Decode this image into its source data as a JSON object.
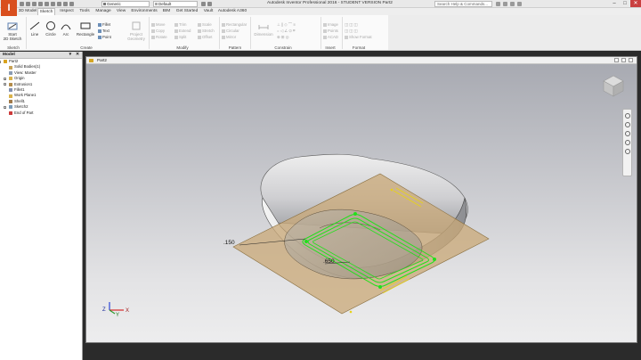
{
  "app": {
    "logo_letter": "I",
    "title": "Autodesk Inventor Professional 2016 - STUDENT VERSION   Part2",
    "search_placeholder": "Search Help & Commands...",
    "quick_access": {
      "material": "Generic",
      "appearance": "Default"
    },
    "window_controls": {
      "minimize": "–",
      "maximize": "□",
      "close": "✕"
    }
  },
  "ribbon": {
    "tabs": [
      "3D Model",
      "Sketch",
      "Inspect",
      "Tools",
      "Manage",
      "View",
      "Environments",
      "BIM",
      "Get Started",
      "Vault",
      "Autodesk A360"
    ],
    "active_tab": "Sketch",
    "start_sketch": {
      "line1": "Start",
      "line2": "2D Sketch"
    },
    "create": {
      "line": "Line",
      "circle": "Circle",
      "arc": "Arc",
      "rectangle": "Rectangle",
      "fillet": "Fillet",
      "text": "Text",
      "point": "Point"
    },
    "project_geometry": {
      "line1": "Project",
      "line2": "Geometry"
    },
    "modify": [
      "Move",
      "Copy",
      "Rotate",
      "Trim",
      "Extend",
      "Split",
      "Scale",
      "Stretch",
      "Offset"
    ],
    "pattern": [
      "Rectangular",
      "Circular",
      "Mirror"
    ],
    "constrain": {
      "dimension": "Dimension"
    },
    "insert": [
      "Image",
      "Points",
      "ACAD"
    ],
    "format": [
      "Show Format"
    ],
    "groups": {
      "sketch": "Sketch",
      "create": "Create",
      "modify": "Modify",
      "pattern": "Pattern",
      "constrain": "Constrain",
      "insert": "Insert",
      "format": "Format"
    }
  },
  "browser": {
    "title": "Model",
    "dropdown": "▾",
    "close": "✕",
    "items": [
      {
        "label": "Part2",
        "icon_color": "#d8a21d"
      },
      {
        "label": "Solid Bodies(1)",
        "icon_color": "#c8a254"
      },
      {
        "label": "View: Master",
        "icon_color": "#8a9bb3"
      },
      {
        "label": "Origin",
        "icon_color": "#d9b24a"
      },
      {
        "label": "Extrusion1",
        "icon_color": "#b38c4a"
      },
      {
        "label": "Fillet1",
        "icon_color": "#7f8fb0"
      },
      {
        "label": "Work Plane1",
        "icon_color": "#d9b24a"
      },
      {
        "label": "Shell1",
        "icon_color": "#a07a4a"
      },
      {
        "label": "Sketch2",
        "icon_color": "#7a9ab8"
      },
      {
        "label": "End of Part",
        "icon_color": "#cc3a3a"
      }
    ]
  },
  "document": {
    "tab": "Part2"
  },
  "viewport": {
    "dim_1": ".150",
    "dim_2": ".650",
    "triad": {
      "z": "Z",
      "x": "X",
      "y": "Y"
    }
  },
  "colors": {
    "sketch": "#22e01c",
    "plane": "#c9a877",
    "accent": "#d94f1e"
  }
}
